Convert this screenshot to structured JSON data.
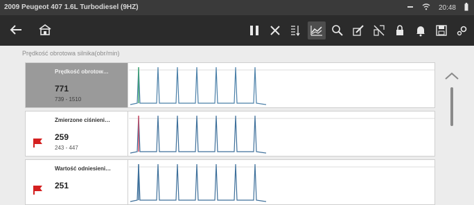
{
  "status_bar": {
    "title": "2009 Peugeot 407 1.6L Turbodiesel (9HZ)",
    "time": "20:48",
    "icons": [
      "minus-icon",
      "wifi-icon",
      "battery-icon"
    ]
  },
  "toolbar": {
    "left": [
      {
        "icon": "back-arrow-icon"
      },
      {
        "icon": "home-icon"
      }
    ],
    "right": [
      {
        "icon": "pause-icon"
      },
      {
        "icon": "close-icon"
      },
      {
        "icon": "pid-list-icon"
      },
      {
        "icon": "graph-view-icon",
        "active": true
      },
      {
        "icon": "zoom-icon"
      },
      {
        "icon": "edit-icon"
      },
      {
        "icon": "filter-icon"
      },
      {
        "icon": "lock-icon"
      },
      {
        "icon": "bell-icon"
      },
      {
        "icon": "save-icon"
      },
      {
        "icon": "settings-icon"
      }
    ]
  },
  "header": {
    "pid_label": "Prędkość obrotowa silnika(obr/min)"
  },
  "graphs": [
    {
      "name": "Prędkość obrotow…",
      "value": "771",
      "range": "739 - 1510",
      "selected": true,
      "flagged": false,
      "trace_color": "#4a7fa8",
      "accent_color": "#3ea86b"
    },
    {
      "name": "Zmierzone ciśnieni…",
      "value": "259",
      "range": "243 - 447",
      "selected": false,
      "flagged": true,
      "trace_color": "#3d6f9a",
      "accent_color": "#d9475e"
    },
    {
      "name": "Wartość odniesieni…",
      "value": "251",
      "range": "",
      "selected": false,
      "flagged": true,
      "trace_color": "#3d6f9a",
      "accent_color": "#3d6f9a"
    }
  ],
  "colors": {
    "toolbar_bg": "#2b2b2b",
    "status_bg": "#3a3a3a",
    "flag": "#d42020",
    "selected_bg": "#9a9a9a"
  }
}
